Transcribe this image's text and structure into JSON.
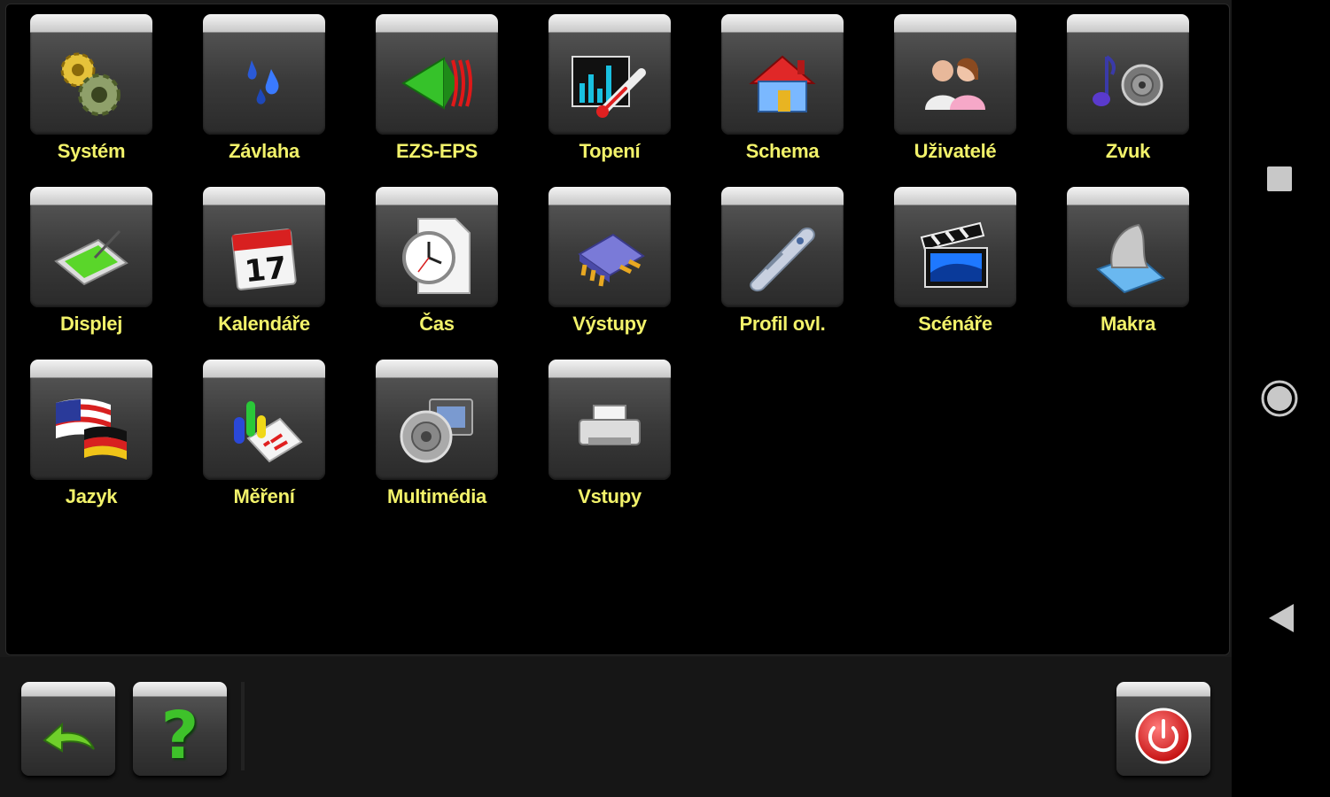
{
  "tiles": [
    {
      "label": "Systém",
      "icon": "gears-icon"
    },
    {
      "label": "Závlaha",
      "icon": "water-drops-icon"
    },
    {
      "label": "EZS-EPS",
      "icon": "alarm-sensor-icon"
    },
    {
      "label": "Topení",
      "icon": "thermometer-chart-icon"
    },
    {
      "label": "Schema",
      "icon": "house-icon"
    },
    {
      "label": "Uživatelé",
      "icon": "users-icon"
    },
    {
      "label": "Zvuk",
      "icon": "music-speaker-icon"
    },
    {
      "label": "Displej",
      "icon": "tablet-pen-icon"
    },
    {
      "label": "Kalendáře",
      "icon": "calendar-icon"
    },
    {
      "label": "Čas",
      "icon": "clock-icon"
    },
    {
      "label": "Výstupy",
      "icon": "chip-icon"
    },
    {
      "label": "Profil ovl.",
      "icon": "remote-control-icon"
    },
    {
      "label": "Scénáře",
      "icon": "clapperboard-icon"
    },
    {
      "label": "Makra",
      "icon": "script-scroll-icon"
    },
    {
      "label": "Jazyk",
      "icon": "flags-icon"
    },
    {
      "label": "Měření",
      "icon": "measurement-chart-icon"
    },
    {
      "label": "Multimédia",
      "icon": "multimedia-speaker-icon"
    },
    {
      "label": "Vstupy",
      "icon": "printer-input-icon"
    }
  ],
  "toolbar": {
    "back_icon": "back-arrow-icon",
    "help_icon": "question-mark-icon",
    "help_glyph": "?",
    "power_icon": "power-icon"
  },
  "nav": {
    "recents_icon": "square-icon",
    "home_icon": "circle-icon",
    "back_icon": "triangle-back-icon"
  },
  "colors": {
    "label": "#f2f26a",
    "panel": "#000000",
    "bar": "#161616",
    "power": "#e02020",
    "help": "#3ec22a"
  }
}
